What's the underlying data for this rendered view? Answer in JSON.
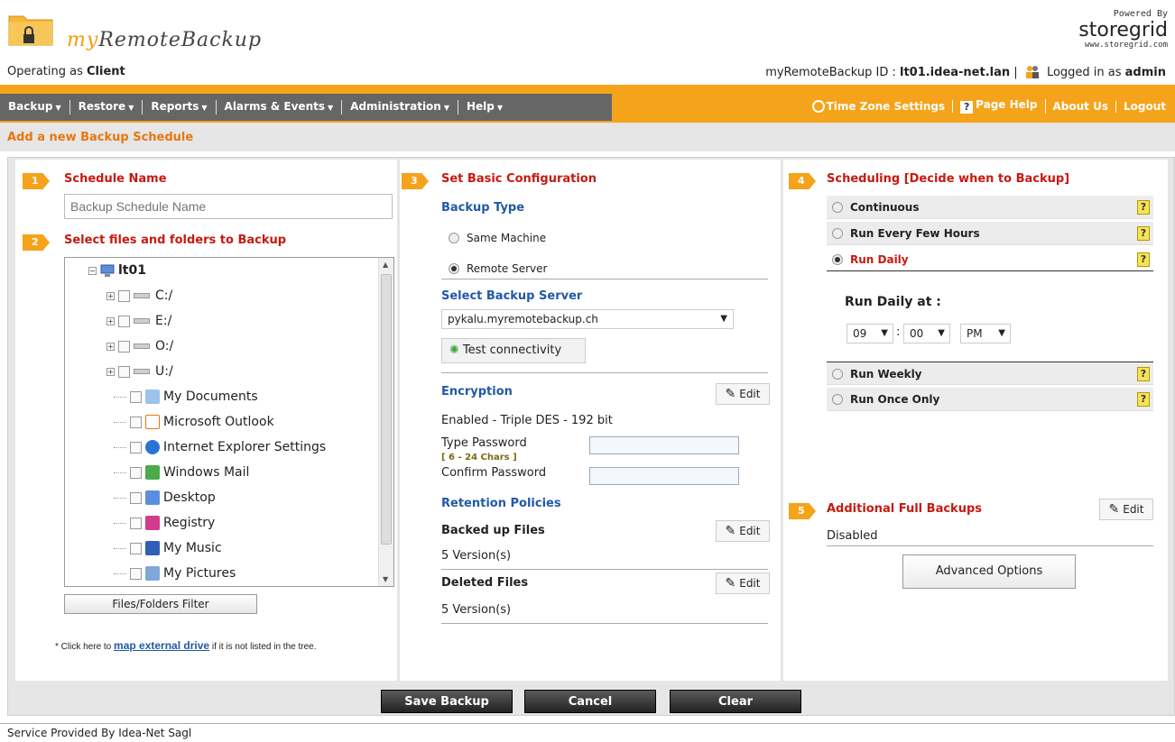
{
  "header": {
    "brand_my": "my",
    "brand_rest": "RemoteBackup",
    "powered_by": "Powered By",
    "storegrid": "storegrid",
    "storegrid_url": "www.storegrid.com",
    "operating_prefix": "Operating as ",
    "operating_role": "Client",
    "id_prefix": "myRemoteBackup ID : ",
    "id_value": "lt01.idea-net.lan",
    "logged_prefix": "Logged in as ",
    "logged_user": "admin"
  },
  "menu": {
    "left": [
      "Backup",
      "Restore",
      "Reports",
      "Alarms & Events",
      "Administration",
      "Help"
    ],
    "right": [
      "Time Zone Settings",
      "Page Help",
      "About Us",
      "Logout"
    ]
  },
  "page_title": "Add a new Backup Schedule",
  "col1": {
    "step1_num": "1",
    "step1_title": "Schedule Name",
    "schedule_placeholder": "Backup Schedule Name",
    "step2_num": "2",
    "step2_title": "Select files and folders to Backup",
    "tree": {
      "root": "lt01",
      "drives": [
        "C:/",
        "E:/",
        "O:/",
        "U:/"
      ],
      "folders": [
        "My Documents",
        "Microsoft Outlook",
        "Internet Explorer Settings",
        "Windows Mail",
        "Desktop",
        "Registry",
        "My Music",
        "My Pictures"
      ]
    },
    "filter_button": "Files/Folders Filter",
    "map_note_pre": "* Click here to ",
    "map_note_link": "map external drive",
    "map_note_post": " if it is not listed in the tree."
  },
  "col2": {
    "step3_num": "3",
    "step3_title": "Set Basic Configuration",
    "backup_type_title": "Backup Type",
    "opt_same": "Same Machine",
    "opt_remote": "Remote Server",
    "select_server_title": "Select Backup Server",
    "server_value": "pykalu.myremotebackup.ch",
    "test_button": "Test connectivity",
    "encryption_title": "Encryption",
    "edit_label": "Edit",
    "enc_status": "Enabled  - Triple DES  -  192  bit",
    "type_password": "Type Password",
    "pwd_hint": "[ 6 - 24 Chars ]",
    "confirm_password": "Confirm Password",
    "retention_title": "Retention Policies",
    "backed_up_title": "Backed up Files",
    "backed_up_value": "5  Version(s)",
    "deleted_title": "Deleted Files",
    "deleted_value": "5  Version(s)"
  },
  "col3": {
    "step4_num": "4",
    "step4_title": "Scheduling [Decide when to Backup]",
    "options": [
      "Continuous",
      "Run Every Few Hours",
      "Run Daily",
      "Run Weekly",
      "Run Once Only"
    ],
    "help_mark": "?",
    "run_daily_at": "Run Daily at :",
    "hour": "09",
    "minute": "00",
    "ampm": "PM",
    "time_sep": ":",
    "step5_num": "5",
    "step5_title": "Additional Full Backups",
    "full_status": "Disabled",
    "advanced_button": "Advanced Options"
  },
  "actions": [
    "Save Backup",
    "Cancel",
    "Clear"
  ],
  "footer": "Service Provided By Idea-Net Sagl"
}
